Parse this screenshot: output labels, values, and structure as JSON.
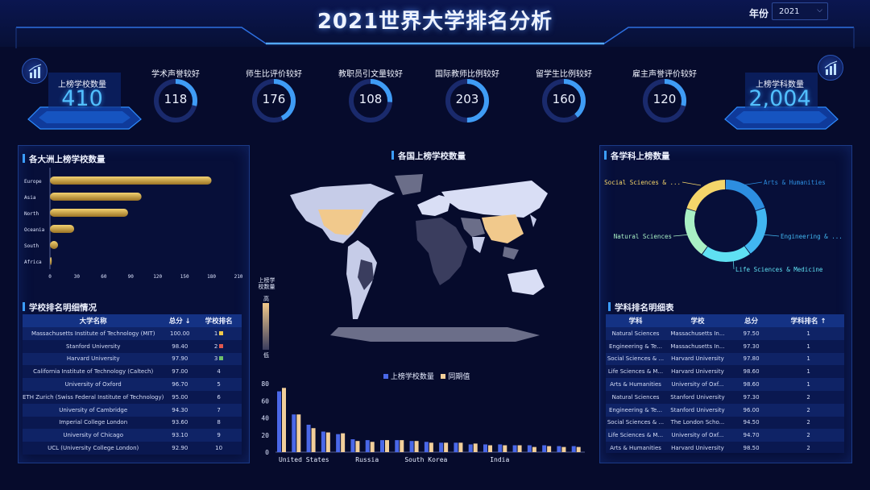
{
  "header": {
    "title": "2021世界大学排名分析",
    "year_label": "年份",
    "year_value": "2021"
  },
  "totals": {
    "left": {
      "label": "上榜学校数量",
      "value": "410"
    },
    "right": {
      "label": "上榜学科数量",
      "value": "2,004"
    }
  },
  "rings": [
    {
      "label": "学术声誉较好",
      "value": "118",
      "fraction": 0.29
    },
    {
      "label": "师生比评价较好",
      "value": "176",
      "fraction": 0.43
    },
    {
      "label": "教职员引文量较好",
      "value": "108",
      "fraction": 0.26
    },
    {
      "label": "国际教师比例较好",
      "value": "203",
      "fraction": 0.5
    },
    {
      "label": "留学生比例较好",
      "value": "160",
      "fraction": 0.39
    },
    {
      "label": "雇主声誉评价较好",
      "value": "120",
      "fraction": 0.29
    }
  ],
  "continents": {
    "title": "各大洲上榜学校数量",
    "chart_data": {
      "type": "bar",
      "categories": [
        "Europe",
        "Asia",
        "North",
        "Oceania",
        "South",
        "Africa"
      ],
      "values": [
        180,
        102,
        87,
        27,
        9,
        2
      ],
      "xlim": [
        0,
        210
      ],
      "ticks": [
        "0",
        "30",
        "60",
        "90",
        "120",
        "150",
        "180",
        "210"
      ],
      "orientation": "horizontal",
      "color": "#d9b24e"
    }
  },
  "map": {
    "title": "各国上榜学校数量",
    "legend_title": "上榜学校数量",
    "legend_high": "高",
    "legend_low": "低"
  },
  "country_bars": {
    "legend": [
      "上榜学校数量",
      "同期值"
    ],
    "chart_data": {
      "type": "bar",
      "x_labels": [
        "United States",
        "Russia",
        "South Korea",
        "India"
      ],
      "ylim": [
        0,
        80
      ],
      "yticks": [
        "80",
        "60",
        "40",
        "20",
        "0"
      ],
      "series": [
        {
          "name": "上榜学校数量",
          "color": "#4a68e8",
          "values": [
            71,
            44,
            32,
            24,
            21,
            15,
            14,
            14,
            14,
            13,
            12,
            11,
            11,
            9,
            9,
            9,
            8,
            8,
            8,
            7,
            7
          ]
        },
        {
          "name": "同期值",
          "color": "#f2cf9a",
          "values": [
            75,
            44,
            28,
            23,
            22,
            13,
            12,
            14,
            14,
            13,
            11,
            11,
            11,
            10,
            8,
            8,
            8,
            6,
            7,
            6,
            6
          ]
        }
      ]
    }
  },
  "school_rank": {
    "title": "学校排名明细情况",
    "columns": [
      "大学名称",
      "总分 ↓",
      "学校排名"
    ],
    "rows": [
      [
        "Massachusetts Institute of Technology (MIT)",
        "100.00",
        "1"
      ],
      [
        "Stanford University",
        "98.40",
        "2"
      ],
      [
        "Harvard University",
        "97.90",
        "3"
      ],
      [
        "California Institute of Technology (Caltech)",
        "97.00",
        "4"
      ],
      [
        "University of Oxford",
        "96.70",
        "5"
      ],
      [
        "ETH Zurich (Swiss Federal Institute of Technology)",
        "95.00",
        "6"
      ],
      [
        "University of Cambridge",
        "94.30",
        "7"
      ],
      [
        "Imperial College London",
        "93.60",
        "8"
      ],
      [
        "University of Chicago",
        "93.10",
        "9"
      ],
      [
        "UCL (University College London)",
        "92.90",
        "10"
      ]
    ],
    "medal_colors": [
      "#f1c84a",
      "#e0584e",
      "#6fc06a"
    ]
  },
  "subjects": {
    "title": "各学科上榜数量",
    "chart_data": {
      "type": "pie",
      "donut": true,
      "labels": [
        "Arts & Humanities",
        "Engineering & ...",
        "Life Sciences & Medicine",
        "Natural Sciences",
        "Social Sciences & ..."
      ],
      "values": [
        20,
        20,
        20,
        20,
        20
      ],
      "colors": [
        "#2d8ee0",
        "#41b6f0",
        "#5fe0f2",
        "#a8f0c4",
        "#f5d56a"
      ]
    }
  },
  "subject_rank": {
    "title": "学科排名明细表",
    "columns": [
      "学科",
      "学校",
      "总分",
      "学科排名 ↑"
    ],
    "rows": [
      [
        "Natural Sciences",
        "Massachusetts In...",
        "97.50",
        "1"
      ],
      [
        "Engineering & Te...",
        "Massachusetts In...",
        "97.30",
        "1"
      ],
      [
        "Social Sciences & ...",
        "Harvard University",
        "97.80",
        "1"
      ],
      [
        "Life Sciences & M...",
        "Harvard University",
        "98.60",
        "1"
      ],
      [
        "Arts & Humanities",
        "University of Oxf...",
        "98.60",
        "1"
      ],
      [
        "Natural Sciences",
        "Stanford University",
        "97.30",
        "2"
      ],
      [
        "Engineering & Te...",
        "Stanford University",
        "96.00",
        "2"
      ],
      [
        "Social Sciences & ...",
        "The London Scho...",
        "94.50",
        "2"
      ],
      [
        "Life Sciences & M...",
        "University of Oxf...",
        "94.70",
        "2"
      ],
      [
        "Arts & Humanities",
        "Harvard University",
        "98.50",
        "2"
      ]
    ]
  }
}
